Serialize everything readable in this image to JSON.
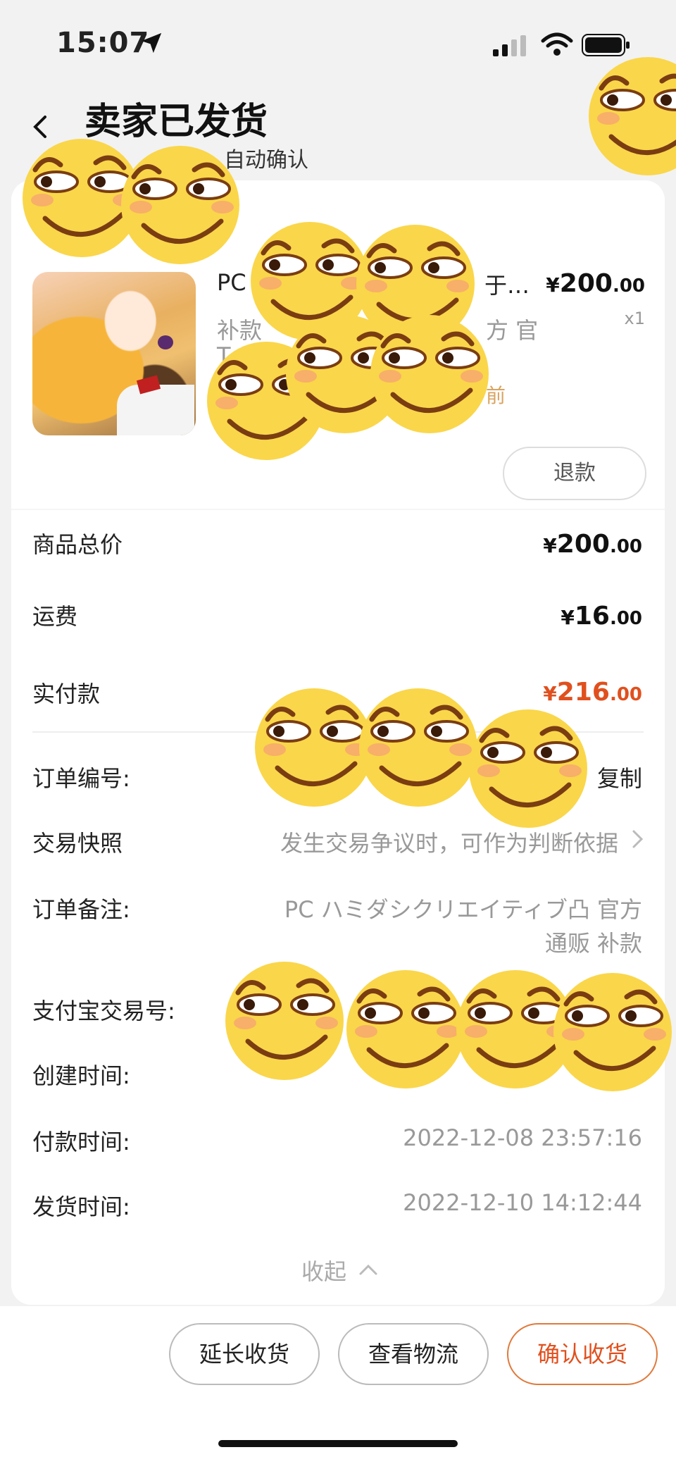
{
  "status_bar": {
    "time": "15:07"
  },
  "header": {
    "title": "卖家已发货",
    "subtitle": "自动确认"
  },
  "product": {
    "title": "PC",
    "title_tail": "于…",
    "sub_line1": "补款",
    "sub_line1_tail": "方 官",
    "sub_line2": "T",
    "tag": "前",
    "price": {
      "currency": "¥",
      "integer": "200",
      "decimal": ".00"
    },
    "quantity": "x1",
    "refund_label": "退款"
  },
  "summary": {
    "items": [
      {
        "label": "商品总价",
        "currency": "¥",
        "integer": "200",
        "decimal": ".00"
      },
      {
        "label": "运费",
        "currency": "¥",
        "integer": "16",
        "decimal": ".00"
      },
      {
        "label": "实付款",
        "currency": "¥",
        "integer": "216",
        "decimal": ".00"
      }
    ]
  },
  "details": {
    "order_no_label": "订单编号:",
    "copy_label": "复制",
    "snapshot_label": "交易快照",
    "snapshot_value": "发生交易争议时，可作为判断依据",
    "remark_label": "订单备注:",
    "remark_line1": "PC ハミダシクリエイティブ凸 官方",
    "remark_line2": "通贩 补款",
    "alipay_label": "支付宝交易号:",
    "created_label": "创建时间:",
    "paid_label": "付款时间:",
    "paid_value": "2022-12-08 23:57:16",
    "shipped_label": "发货时间:",
    "shipped_value": "2022-12-10 14:12:44",
    "collapse_label": "收起"
  },
  "bottom_actions": {
    "extend": "延长收货",
    "logistics": "查看物流",
    "confirm": "确认收货"
  },
  "colors": {
    "accent": "#e0501e",
    "tag": "#d9a460",
    "emoji": "#fad64a"
  }
}
